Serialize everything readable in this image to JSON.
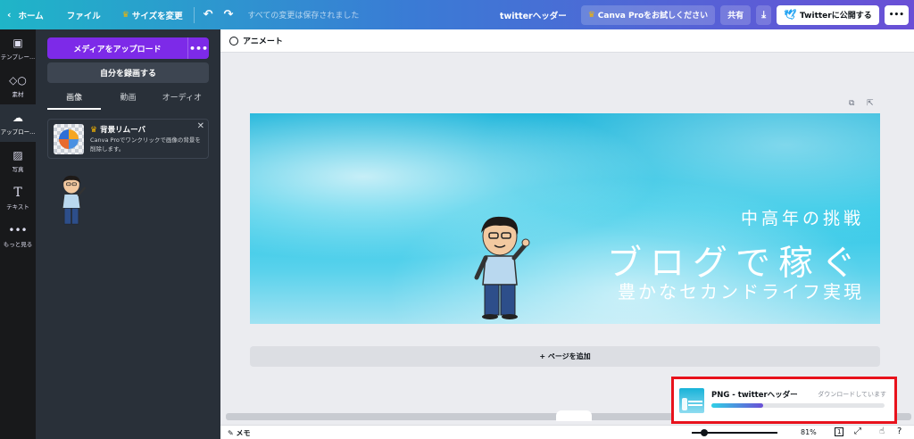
{
  "topbar": {
    "home": "ホーム",
    "file": "ファイル",
    "resize": "サイズを変更",
    "saved_status": "すべての変更は保存されました",
    "doc_title": "twitterヘッダー",
    "canva_pro": "Canva Proをお試しください",
    "share": "共有",
    "publish": "Twitterに公開する",
    "more": "•••"
  },
  "rail": {
    "items": [
      {
        "label": "テンプレー...",
        "icon": "template-icon"
      },
      {
        "label": "素材",
        "icon": "elements-icon"
      },
      {
        "label": "アップロー...",
        "icon": "upload-icon"
      },
      {
        "label": "写真",
        "icon": "photo-icon"
      },
      {
        "label": "テキスト",
        "icon": "text-icon"
      },
      {
        "label": "もっと見る",
        "icon": "more-icon"
      }
    ]
  },
  "panel": {
    "upload_button": "メディアをアップロード",
    "upload_more": "•••",
    "record_button": "自分を録画する",
    "tabs": [
      "画像",
      "動画",
      "オーディオ"
    ],
    "promo": {
      "title": "背景リムーバ",
      "description": "Canva Proでワンクリックで画像の背景を削除します。"
    }
  },
  "editor": {
    "animate": "アニメート",
    "add_page": "+ ページを追加"
  },
  "canvas": {
    "line1": "中高年の挑戦",
    "line2": "ブログで稼ぐ",
    "line3": "豊かなセカンドライフ実現"
  },
  "bottombar": {
    "memo": "メモ",
    "zoom": "81%",
    "page_num": "1"
  },
  "toast": {
    "title": "PNG - twitterヘッダー",
    "status": "ダウンロードしています",
    "progress": 0.3
  },
  "colors": {
    "accent_purple": "#7d2ae8",
    "highlight_red": "#e8121c",
    "twitter_blue": "#1da1f2"
  }
}
